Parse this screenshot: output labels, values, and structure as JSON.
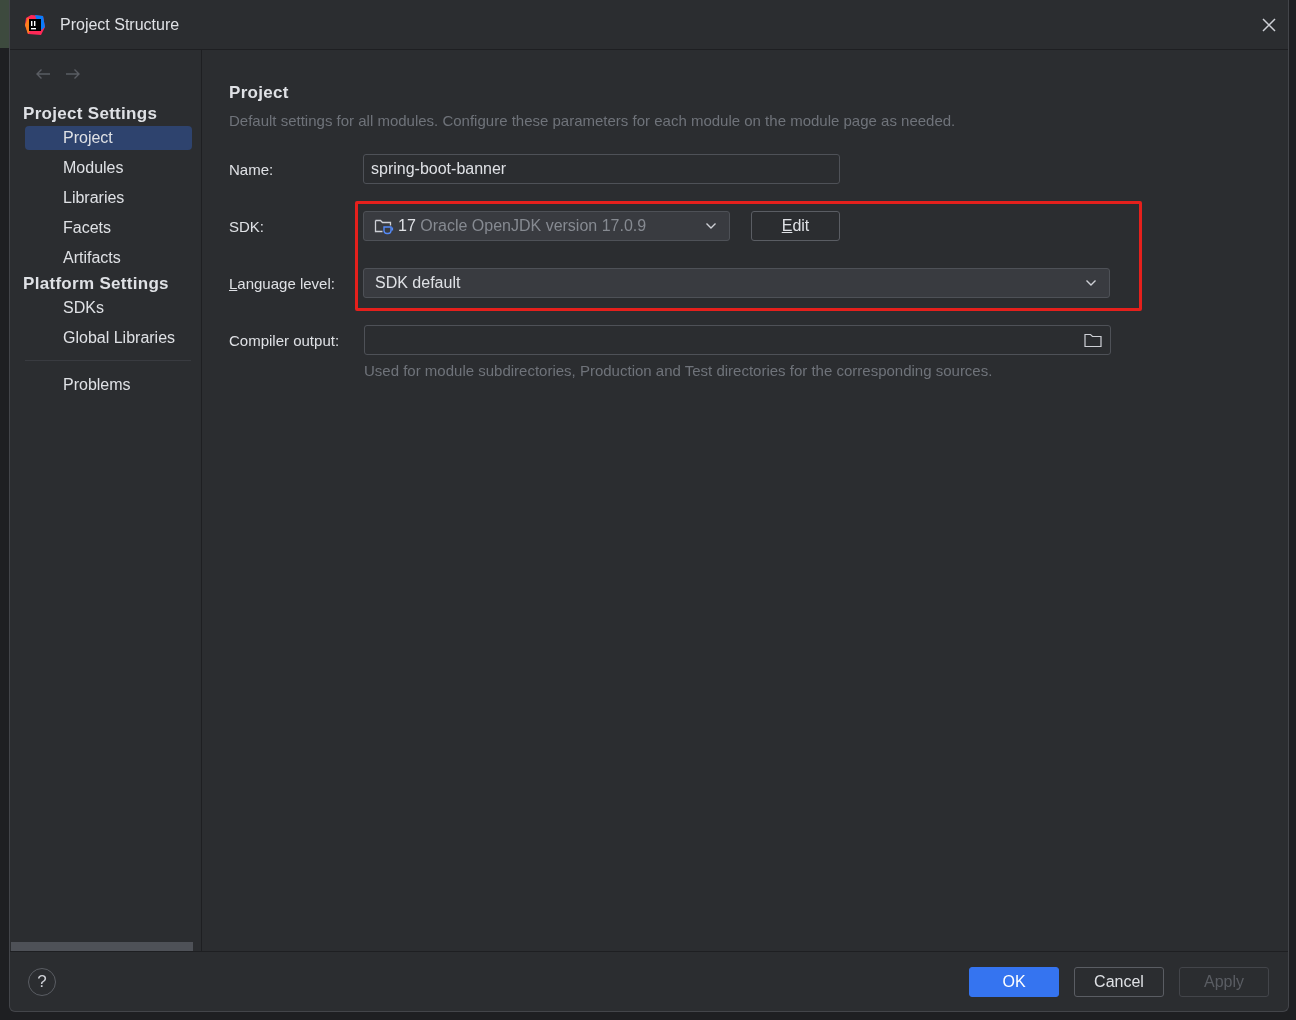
{
  "window": {
    "title": "Project Structure"
  },
  "navigation": {
    "back_enabled": false,
    "forward_enabled": false
  },
  "sidebar": {
    "sections": [
      {
        "heading": "Project Settings",
        "items": [
          {
            "label": "Project",
            "selected": true
          },
          {
            "label": "Modules",
            "selected": false
          },
          {
            "label": "Libraries",
            "selected": false
          },
          {
            "label": "Facets",
            "selected": false
          },
          {
            "label": "Artifacts",
            "selected": false
          }
        ]
      },
      {
        "heading": "Platform Settings",
        "items": [
          {
            "label": "SDKs",
            "selected": false
          },
          {
            "label": "Global Libraries",
            "selected": false
          }
        ]
      }
    ],
    "extra_items": [
      {
        "label": "Problems",
        "selected": false
      }
    ]
  },
  "panel": {
    "title": "Project",
    "description": "Default settings for all modules. Configure these parameters for each module on the module page as needed.",
    "fields": [
      {
        "kind": "text",
        "label": "Name:",
        "mnemonic": false,
        "highlighted": false,
        "value": "spring-boot-banner"
      },
      {
        "kind": "sdk",
        "label": "SDK:",
        "mnemonic": false,
        "highlighted": true,
        "version": "17",
        "value": "Oracle OpenJDK version 17.0.9",
        "button": {
          "label": "Edit",
          "mnemonic": true
        }
      },
      {
        "kind": "combo",
        "label": "Language level:",
        "mnemonic": true,
        "highlighted": true,
        "value": "SDK default"
      },
      {
        "kind": "path",
        "label": "Compiler output:",
        "mnemonic": false,
        "highlighted": false,
        "hint": "Used for module subdirectories, Production and Test directories for the corresponding sources."
      }
    ]
  },
  "footer": {
    "help": "?",
    "buttons": [
      {
        "label": "OK",
        "kind": "primary",
        "disabled": false
      },
      {
        "label": "Cancel",
        "kind": "normal",
        "disabled": false
      },
      {
        "label": "Apply",
        "kind": "normal",
        "disabled": true
      }
    ]
  }
}
